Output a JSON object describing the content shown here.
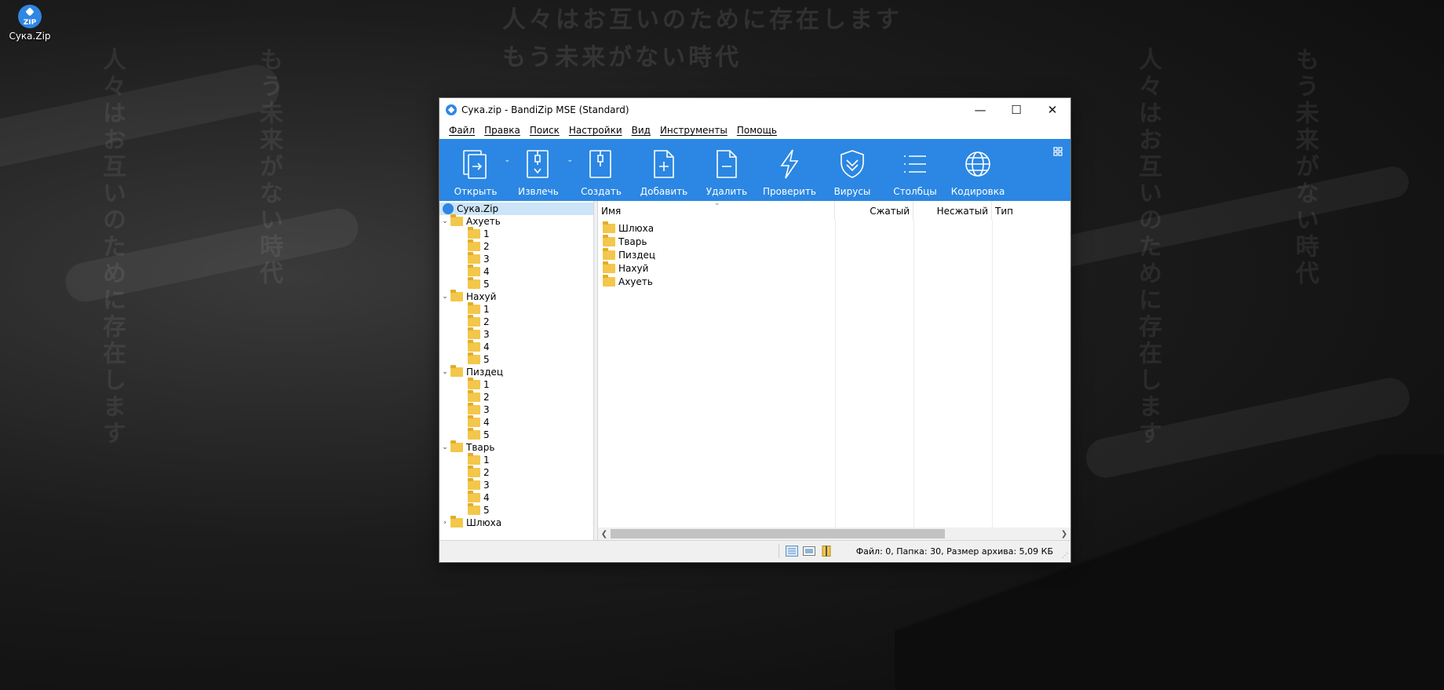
{
  "desktop": {
    "icon_badge": "ZIP",
    "icon_label": "Сука.Zip",
    "wallpaper_line1": "人々はお互いのために存在します",
    "wallpaper_line2": "もう未来がない時代"
  },
  "window": {
    "title": "Сука.zip - BandiZip MSE (Standard)",
    "controls": {
      "minimize": "—",
      "maximize": "☐",
      "close": "✕"
    }
  },
  "menu": [
    "Файл",
    "Правка",
    "Поиск",
    "Настройки",
    "Вид",
    "Инструменты",
    "Помощь"
  ],
  "toolbar": {
    "open": "Открыть",
    "extract": "Извлечь",
    "create": "Создать",
    "add": "Добавить",
    "delete": "Удалить",
    "test": "Проверить",
    "virus": "Вирусы",
    "columns": "Столбцы",
    "encoding": "Кодировка",
    "accent_color": "#2b87e3"
  },
  "tree": {
    "root": "Сука.Zip",
    "folders": [
      {
        "name": "Ахуеть",
        "expanded": true,
        "children": [
          "1",
          "2",
          "3",
          "4",
          "5"
        ]
      },
      {
        "name": "Нахуй",
        "expanded": true,
        "children": [
          "1",
          "2",
          "3",
          "4",
          "5"
        ]
      },
      {
        "name": "Пиздец",
        "expanded": true,
        "children": [
          "1",
          "2",
          "3",
          "4",
          "5"
        ]
      },
      {
        "name": "Тварь",
        "expanded": true,
        "children": [
          "1",
          "2",
          "3",
          "4",
          "5"
        ]
      },
      {
        "name": "Шлюха",
        "expanded": false,
        "children": []
      }
    ]
  },
  "list": {
    "columns": {
      "name": "Имя",
      "packed": "Сжатый",
      "size": "Несжатый",
      "type": "Тип"
    },
    "rows": [
      "Шлюха",
      "Тварь",
      "Пиздец",
      "Нахуй",
      "Ахуеть"
    ]
  },
  "status": {
    "text": "Файл: 0, Папка: 30, Размер архива: 5,09 КБ"
  }
}
